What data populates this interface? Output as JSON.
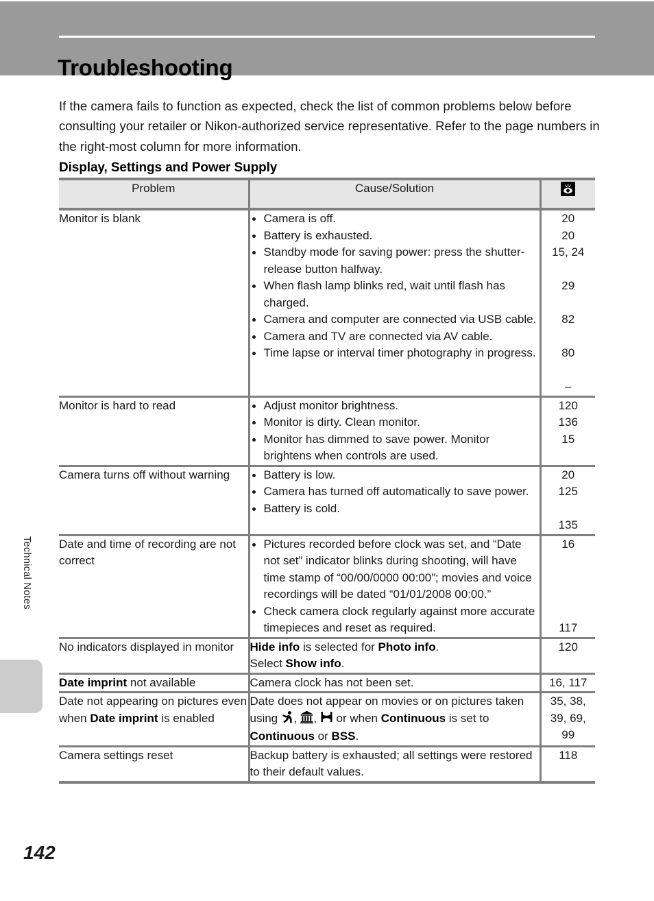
{
  "header": {
    "title": "Troubleshooting"
  },
  "intro": "If the camera fails to function as expected, check the list of common problems below before consulting your retailer or Nikon-authorized service representative. Refer to the page numbers in the right-most column for more information.",
  "section_heading": "Display, Settings and Power Supply",
  "side_tab": {
    "label": "Technical Notes"
  },
  "footer": {
    "page_number": "142"
  },
  "table": {
    "headers": {
      "problem": "Problem",
      "cause": "Cause/Solution",
      "page_ref_icon": "page-reference-icon"
    },
    "rows": [
      {
        "problem": "Monitor is blank",
        "bullets": [
          "Camera is off.",
          "Battery is exhausted.",
          "Standby mode for saving power: press the shutter-release button halfway.",
          "When flash lamp blinks red, wait until flash has charged.",
          "Camera and computer are connected via USB cable.",
          "Camera and TV are connected via AV cable.",
          "Time lapse or interval timer photography in progress."
        ],
        "pages": [
          "20",
          "20",
          "15, 24",
          "",
          "29",
          "",
          "82",
          "",
          "80",
          "",
          "–"
        ]
      },
      {
        "problem": "Monitor is hard to read",
        "bullets": [
          "Adjust monitor brightness.",
          "Monitor is dirty. Clean monitor.",
          "Monitor has dimmed to save power. Monitor brightens when controls are used."
        ],
        "pages": [
          "120",
          "136",
          "15",
          ""
        ]
      },
      {
        "problem": "Camera turns off without warning",
        "bullets": [
          "Battery is low.",
          "Camera has turned off automatically to save power.",
          "Battery is cold."
        ],
        "pages": [
          "20",
          "125",
          "",
          "135"
        ]
      },
      {
        "problem": "Date and time of recording are not correct",
        "bullets": [
          "Pictures recorded before clock was set, and “Date not set” indicator blinks during shooting, will have time stamp of “00/00/0000 00:00”; movies and voice recordings will be dated “01/01/2008 00:00.”",
          "Check camera clock regularly against more accurate timepieces and reset as required."
        ],
        "pages": [
          "16",
          "",
          "",
          "",
          "",
          "117",
          ""
        ]
      },
      {
        "problem": "No indicators displayed in monitor",
        "cause_line1_pre": "",
        "cause_bold1": "Hide info",
        "cause_mid1": " is selected for ",
        "cause_bold2": "Photo info",
        "cause_end1": ".",
        "cause_line2_pre": "Select ",
        "cause_bold3": "Show info",
        "cause_end2": ".",
        "pages": [
          "120",
          ""
        ]
      },
      {
        "problem_bold": "Date imprint",
        "problem_rest": " not available",
        "cause": "Camera clock has not been set.",
        "pages": [
          "16, 117"
        ]
      },
      {
        "problem_pre": "Date not appearing on pictures even when ",
        "problem_bold": "Date imprint",
        "problem_post": " is enabled",
        "cause_pre": "Date does not appear on movies or on pictures taken using ",
        "cause_icons": [
          "sports-icon",
          "museum-icon",
          "panorama-assist-icon"
        ],
        "cause_mid": " or when ",
        "cause_bold1": "Continuous",
        "cause_mid2": " is set to ",
        "cause_bold2": "Continuous",
        "cause_mid3": " or ",
        "cause_bold3": "BSS",
        "cause_end": ".",
        "pages": [
          "35, 38,",
          "39, 69,",
          "99"
        ]
      },
      {
        "problem": "Camera settings reset",
        "cause": "Backup battery is exhausted; all settings were restored to their default values.",
        "pages": [
          "118",
          ""
        ]
      }
    ]
  }
}
